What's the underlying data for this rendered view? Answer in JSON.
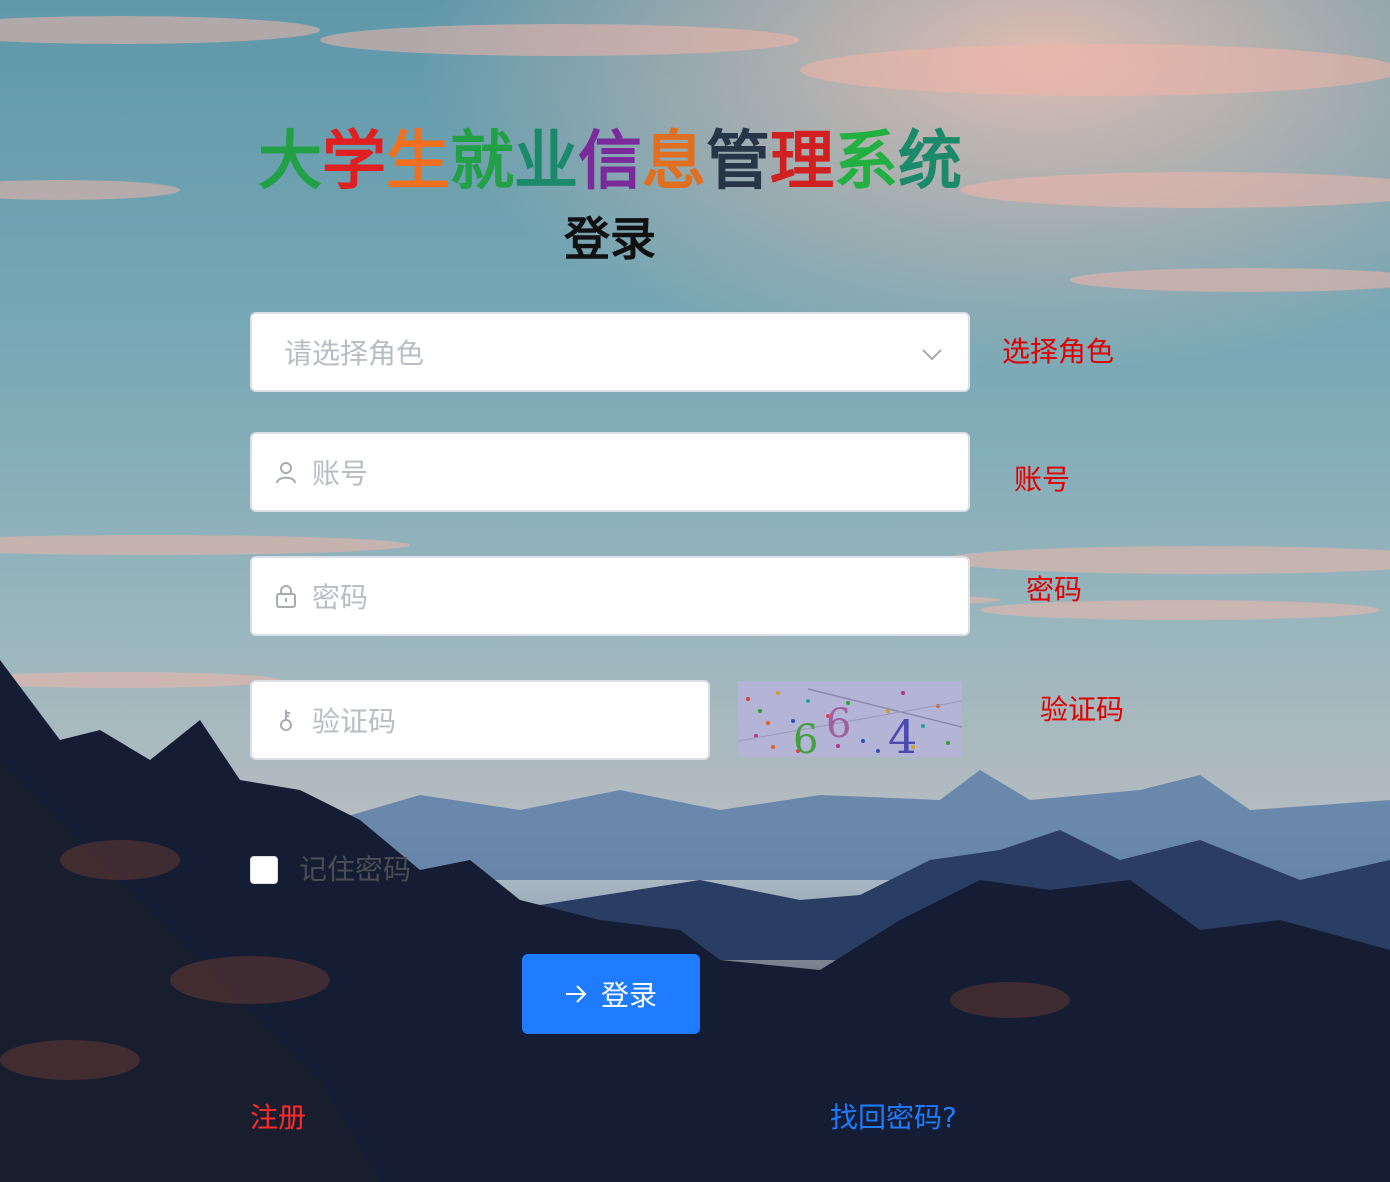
{
  "title": {
    "chars": [
      {
        "char": "大",
        "color": "#22a045"
      },
      {
        "char": "学",
        "color": "#e02020"
      },
      {
        "char": "生",
        "color": "#f07020"
      },
      {
        "char": "就",
        "color": "#22a045"
      },
      {
        "char": "业",
        "color": "#1a8a6a"
      },
      {
        "char": "信",
        "color": "#7a2a9a"
      },
      {
        "char": "息",
        "color": "#e07020"
      },
      {
        "char": "管",
        "color": "#263548"
      },
      {
        "char": "理",
        "color": "#d02020"
      },
      {
        "char": "系",
        "color": "#22b040"
      },
      {
        "char": "统",
        "color": "#1a8a6a"
      }
    ]
  },
  "subtitle": "登录",
  "form": {
    "role": {
      "placeholder": "请选择角色",
      "side_label": "选择角色",
      "icon": "chevron-down-icon"
    },
    "account": {
      "placeholder": "账号",
      "side_label": "账号",
      "icon": "user-icon"
    },
    "password": {
      "placeholder": "密码",
      "side_label": "密码",
      "icon": "lock-icon"
    },
    "captcha": {
      "placeholder": "验证码",
      "side_label": "验证码",
      "icon": "key-icon",
      "code": "664"
    },
    "remember_label": "记住密码",
    "remember_checked": false,
    "login_button": "登录",
    "register_link": "注册",
    "forgot_link": "找回密码?"
  },
  "colors": {
    "primary": "#1f7bff",
    "side_label": "#e00000",
    "register": "#ff2a2a"
  }
}
